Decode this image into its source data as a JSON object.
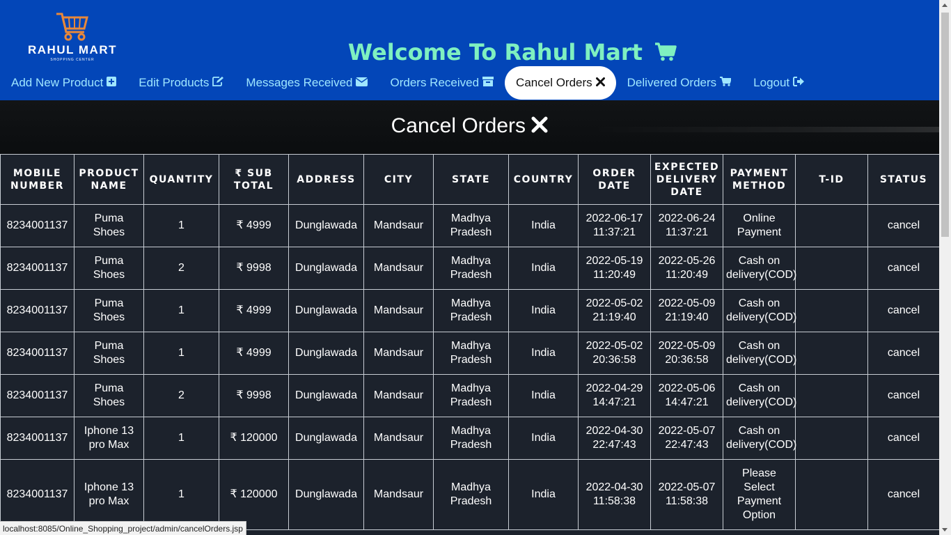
{
  "logo": {
    "name": "RAHUL MART",
    "tagline": "SHOPPING CENTER"
  },
  "header": {
    "welcome": "Welcome To Rahul Mart"
  },
  "nav": [
    {
      "label": "Add New Product",
      "icon": "plus-square-icon"
    },
    {
      "label": "Edit Products",
      "icon": "edit-icon"
    },
    {
      "label": "Messages Received",
      "icon": "envelope-icon"
    },
    {
      "label": "Orders Received",
      "icon": "archive-icon"
    },
    {
      "label": "Cancel Orders",
      "icon": "close-icon",
      "active": true
    },
    {
      "label": "Delivered Orders",
      "icon": "cart-icon"
    },
    {
      "label": "Logout",
      "icon": "logout-icon"
    }
  ],
  "page": {
    "title": "Cancel Orders"
  },
  "table": {
    "headers": [
      "MOBILE NUMBER",
      "PRODUCT NAME",
      "QUANTITY",
      "₹ SUB TOTAL",
      "ADDRESS",
      "CITY",
      "STATE",
      "COUNTRY",
      "ORDER DATE",
      "EXPECTED DELIVERY DATE",
      "PAYMENT METHOD",
      "T-ID",
      "STATUS"
    ],
    "rows": [
      [
        "8234001137",
        "Puma Shoes",
        "1",
        "₹ 4999",
        "Dunglawada",
        "Mandsaur",
        "Madhya Pradesh",
        "India",
        "2022-06-17 11:37:21",
        "2022-06-24 11:37:21",
        "Online Payment",
        "",
        "cancel"
      ],
      [
        "8234001137",
        "Puma Shoes",
        "2",
        "₹ 9998",
        "Dunglawada",
        "Mandsaur",
        "Madhya Pradesh",
        "India",
        "2022-05-19 11:20:49",
        "2022-05-26 11:20:49",
        "Cash on delivery(COD)",
        "",
        "cancel"
      ],
      [
        "8234001137",
        "Puma Shoes",
        "1",
        "₹ 4999",
        "Dunglawada",
        "Mandsaur",
        "Madhya Pradesh",
        "India",
        "2022-05-02 21:19:40",
        "2022-05-09 21:19:40",
        "Cash on delivery(COD)",
        "",
        "cancel"
      ],
      [
        "8234001137",
        "Puma Shoes",
        "1",
        "₹ 4999",
        "Dunglawada",
        "Mandsaur",
        "Madhya Pradesh",
        "India",
        "2022-05-02 20:36:58",
        "2022-05-09 20:36:58",
        "Cash on delivery(COD)",
        "",
        "cancel"
      ],
      [
        "8234001137",
        "Puma Shoes",
        "2",
        "₹ 9998",
        "Dunglawada",
        "Mandsaur",
        "Madhya Pradesh",
        "India",
        "2022-04-29 14:47:21",
        "2022-05-06 14:47:21",
        "Cash on delivery(COD)",
        "",
        "cancel"
      ],
      [
        "8234001137",
        "Iphone 13 pro Max",
        "1",
        "₹ 120000",
        "Dunglawada",
        "Mandsaur",
        "Madhya Pradesh",
        "India",
        "2022-04-30 22:47:43",
        "2022-05-07 22:47:43",
        "Cash on delivery(COD)",
        "",
        "cancel"
      ],
      [
        "8234001137",
        "Iphone 13 pro Max",
        "1",
        "₹ 120000",
        "Dunglawada",
        "Mandsaur",
        "Madhya Pradesh",
        "India",
        "2022-04-30 11:58:38",
        "2022-05-07 11:58:38",
        "Please Select Payment Option",
        "",
        "cancel"
      ]
    ]
  },
  "statusbar": {
    "url": "localhost:8085/Online_Shopping_project/admin/cancelOrders.jsp"
  },
  "colors": {
    "header_bg": "#0346b8",
    "nav_text": "#9fe6ff",
    "welcome_text": "#7ff0c0",
    "table_bg": "#1c222c"
  }
}
